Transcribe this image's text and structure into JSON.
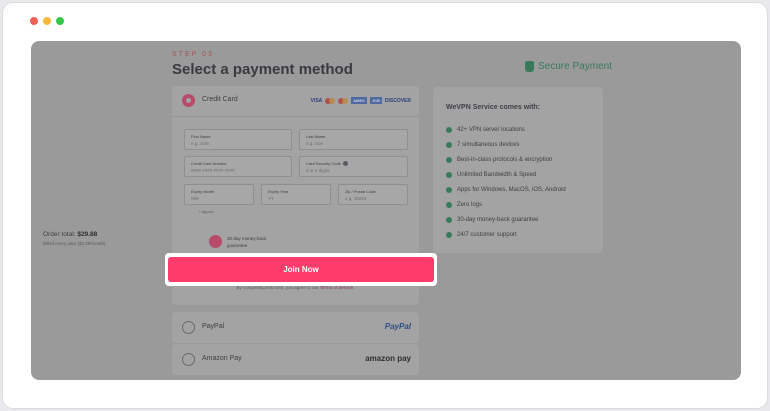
{
  "header": {
    "step": "STEP 03",
    "title": "Select a payment method",
    "secure_label": "Secure Payment"
  },
  "credit_card": {
    "label": "Credit Card",
    "logos": [
      "VISA",
      "AMEX",
      "DISCOVER"
    ],
    "fields": {
      "first_name": {
        "label": "First Name",
        "placeholder": "e.g. John"
      },
      "last_name": {
        "label": "Last Name",
        "placeholder": "e.g. Doe"
      },
      "card_number": {
        "label": "Credit Card Number",
        "placeholder": "#### #### #### ####"
      },
      "security_code": {
        "label": "Card Security Code",
        "placeholder": "3 or 4 digits"
      },
      "expiry_month": {
        "label": "Expiry Month",
        "placeholder": "MM"
      },
      "expiry_year": {
        "label": "Expiry Year",
        "placeholder": "YY"
      },
      "zip": {
        "label": "Zip / Postal Code",
        "placeholder": "e.g. 49283"
      }
    },
    "approx": "* Approx"
  },
  "order": {
    "total_label": "Order total:",
    "total_value": "$29.88",
    "billed": "Billed every year ($2.49/month)",
    "guarantee": "30-day money-back guarantee"
  },
  "cta": {
    "label": "Join Now",
    "terms_prefix": "By completing this form, you agree to our",
    "terms_link": "Terms of Service."
  },
  "alternatives": [
    {
      "label": "PayPal",
      "brand": "PayPal"
    },
    {
      "label": "Amazon Pay",
      "brand": "amazon pay"
    }
  ],
  "service": {
    "title": "WeVPN Service comes with:",
    "features": [
      "42+ VPN server locations",
      "7 simultaneous devices",
      "Best-in-class protocols & encryption",
      "Unlimited Bandwidth & Speed",
      "Apps for Windows, MacOS, iOS, Android",
      "Zero logs",
      "30-day money-back guarantee",
      "24/7 customer support"
    ]
  },
  "colors": {
    "accent": "#ff3b6b",
    "overlay": "#9a9a9a",
    "secure": "#3a7a5c"
  }
}
